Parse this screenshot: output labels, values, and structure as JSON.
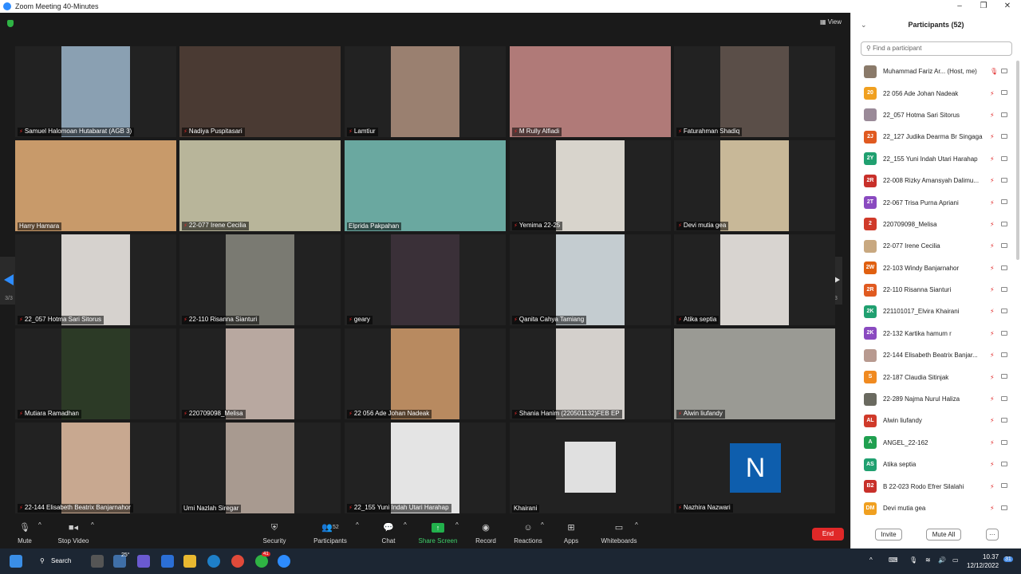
{
  "window": {
    "title": "Zoom Meeting 40-Minutes",
    "minimize": "–",
    "maximize": "❐",
    "close": "✕"
  },
  "view_label": "View",
  "page_indicator": "3/3",
  "tiles": [
    {
      "name": "Samuel Halomoan Hutabarat (AGB 3)",
      "bg": "#8aa0b2",
      "vw": 86,
      "muted": true
    },
    {
      "name": "Nadiya Puspitasari",
      "bg": "#4a3a33",
      "vw": 202,
      "muted": true
    },
    {
      "name": "Lamtiur",
      "bg": "#9a8070",
      "vw": 86,
      "muted": true
    },
    {
      "name": "M Rully Alfiadi",
      "bg": "#b07a78",
      "vw": 202,
      "muted": true
    },
    {
      "name": "Faturahman Shadiq",
      "bg": "#5a4e48",
      "vw": 86,
      "muted": true
    },
    {
      "name": "Harry Hamara",
      "bg": "#c89a6a",
      "vw": 202,
      "muted": false
    },
    {
      "name": "22-077 Irene Cecilia",
      "bg": "#b8b59a",
      "vw": 202,
      "muted": true
    },
    {
      "name": "Elprida Pakpahan",
      "bg": "#6aa8a0",
      "vw": 202,
      "muted": false
    },
    {
      "name": "Yemima 22-25",
      "bg": "#d8d4cc",
      "vw": 86,
      "muted": true
    },
    {
      "name": "Devi mutia gea",
      "bg": "#c8b898",
      "vw": 86,
      "muted": true
    },
    {
      "name": "22_057 Hotma Sari Sitorus",
      "bg": "#d6d2ce",
      "vw": 86,
      "muted": true
    },
    {
      "name": "22-110 Risanna Sianturi",
      "bg": "#7a7a72",
      "vw": 86,
      "muted": true
    },
    {
      "name": "geary",
      "bg": "#3a3038",
      "vw": 86,
      "muted": true
    },
    {
      "name": "Qanita Cahya Tamiang",
      "bg": "#c4ccd0",
      "vw": 86,
      "muted": true
    },
    {
      "name": "Atika septia",
      "bg": "#d8d4d0",
      "vw": 86,
      "muted": true
    },
    {
      "name": "Mutiara Ramadhan",
      "bg": "#2c3a26",
      "vw": 86,
      "muted": true
    },
    {
      "name": "220709098_Melisa",
      "bg": "#b8a8a0",
      "vw": 86,
      "muted": true
    },
    {
      "name": "22 056 Ade Johan Nadeak",
      "bg": "#b88a60",
      "vw": 86,
      "muted": true
    },
    {
      "name": "Shania Hanim (220501132)FEB EP",
      "bg": "#d4d0cc",
      "vw": 86,
      "muted": true
    },
    {
      "name": "Alwin liufandy",
      "bg": "#9a9a94",
      "vw": 202,
      "muted": true
    },
    {
      "name": "22-144 Elisabeth Beatrix Banjarnahor",
      "bg": "#c8a890",
      "vw": 86,
      "muted": true
    },
    {
      "name": "Umi Nazlah Siregar",
      "bg": "#a89a90",
      "vw": 86,
      "muted": false
    },
    {
      "name": "22_155 Yuni Indah Utari Harahap",
      "bg": "#e4e4e4",
      "vw": 86,
      "muted": true
    },
    {
      "name": "Khairani",
      "bg": "#e0e0e0",
      "vw": 64,
      "muted": false
    },
    {
      "name": "Nazhira Nazwari",
      "bg": "#222222",
      "vw": 0,
      "muted": true,
      "avatar_letter": "N"
    }
  ],
  "toolbar": {
    "mute": "Mute",
    "stop_video": "Stop Video",
    "security": "Security",
    "participants": "Participants",
    "participants_count": "52",
    "chat": "Chat",
    "share_screen": "Share Screen",
    "record": "Record",
    "reactions": "Reactions",
    "apps": "Apps",
    "whiteboards": "Whiteboards",
    "end": "End"
  },
  "panel": {
    "title": "Participants (52)",
    "search_placeholder": "Find a participant",
    "invite": "Invite",
    "mute_all": "Mute All",
    "more": "···",
    "participants": [
      {
        "initials": "",
        "name": "Muhammad Fariz Ar... (Host, me)",
        "color": "#8a7a6a"
      },
      {
        "initials": "20",
        "name": "22 056 Ade Johan Nadeak",
        "color": "#f0a020"
      },
      {
        "initials": "",
        "name": "22_057 Hotma Sari Sitorus",
        "color": "#9a8a98"
      },
      {
        "initials": "2J",
        "name": "22_127 Judika Dearma Br Singaga",
        "color": "#e05a20"
      },
      {
        "initials": "2Y",
        "name": "22_155 Yuni Indah Utari Harahap",
        "color": "#20a070"
      },
      {
        "initials": "2R",
        "name": "22-008 Rizky Amansyah Dalimu...",
        "color": "#c8302a"
      },
      {
        "initials": "2T",
        "name": "22-067 Trisa Purna Apriani",
        "color": "#8a4ac0"
      },
      {
        "initials": "2",
        "name": "220709098_Melisa",
        "color": "#d03a2a"
      },
      {
        "initials": "",
        "name": "22-077 Irene Cecilia",
        "color": "#c8a880"
      },
      {
        "initials": "2W",
        "name": "22-103 Windy Banjarnahor",
        "color": "#e06010"
      },
      {
        "initials": "2R",
        "name": "22-110 Risanna Sianturi",
        "color": "#e05a20"
      },
      {
        "initials": "2K",
        "name": "221101017_Elvira Khairani",
        "color": "#20a070"
      },
      {
        "initials": "2K",
        "name": "22-132 Kartika hamum r",
        "color": "#8a4ac0"
      },
      {
        "initials": "",
        "name": "22-144 Elisabeth Beatrix Banjar...",
        "color": "#b89a90"
      },
      {
        "initials": "S",
        "name": "22-187 Claudia Sitinjak",
        "color": "#f08a20"
      },
      {
        "initials": "",
        "name": "22-289 Najma Nurul Haliza",
        "color": "#6a6a60"
      },
      {
        "initials": "AL",
        "name": "Alwin liufandy",
        "color": "#d03a2a"
      },
      {
        "initials": "A",
        "name": "ANGEL_22-162",
        "color": "#20a050"
      },
      {
        "initials": "AS",
        "name": "Atika septia",
        "color": "#20a070"
      },
      {
        "initials": "B2",
        "name": "B 22-023 Rodo Efrer Silalahi",
        "color": "#c8302a"
      },
      {
        "initials": "DM",
        "name": "Devi mutia gea",
        "color": "#f0a020"
      }
    ]
  },
  "taskbar": {
    "search": "Search",
    "weather": "25°",
    "badge": "41",
    "time": "10.37",
    "date": "12/12/2022",
    "notif": "31"
  }
}
